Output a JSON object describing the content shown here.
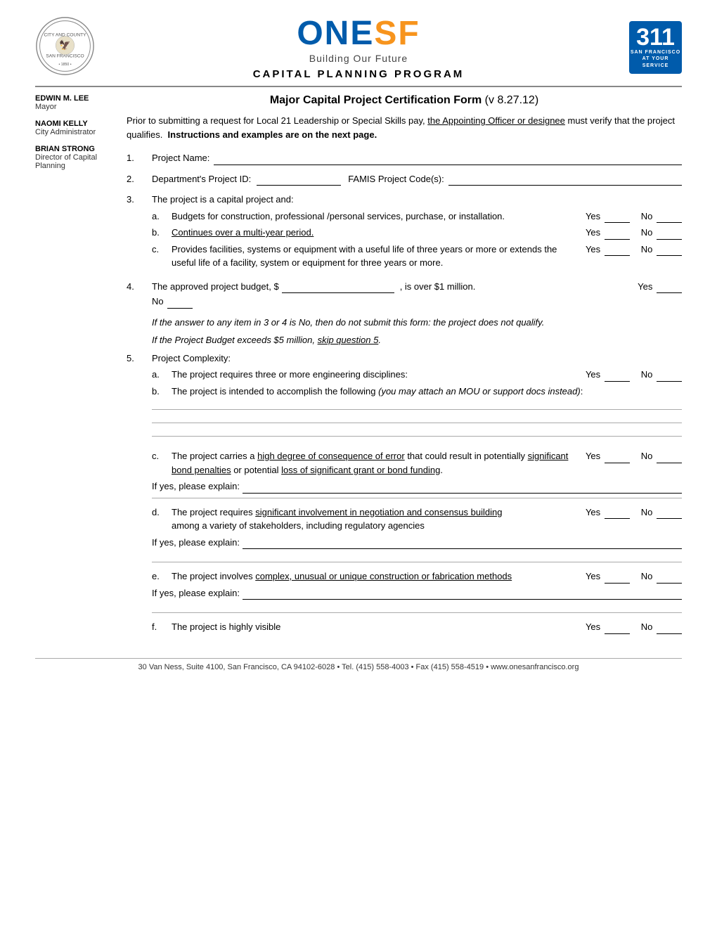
{
  "header": {
    "onesf_one": "ONE",
    "onesf_sf": "SF",
    "onesf_sub": "Building Our Future",
    "program_title": "CAPITAL PLANNING PROGRAM"
  },
  "badge": {
    "number": "311",
    "city": "SAN FRANCISCO",
    "service": "AT YOUR SERVICE"
  },
  "sidebar": {
    "person1_name": "EDWIN M. LEE",
    "person1_title": "Mayor",
    "person2_name": "NAOMI KELLY",
    "person2_title": "City Administrator",
    "person3_name": "BRIAN STRONG",
    "person3_title": "Director of Capital Planning"
  },
  "form": {
    "title": "Major Capital Project Certification Form",
    "version": "(v 8.27.12)",
    "intro": "Prior to submitting a request for Local 21 Leadership or Special Skills pay, the Appointing Officer or designee must verify that the project qualifies.",
    "intro_bold": "Instructions and examples are on the next page.",
    "q1_label": "Project Name:",
    "q2_dept_label": "Department's Project ID:",
    "q2_famis_label": "FAMIS Project Code(s):",
    "q3_label": "The project is a capital project and:",
    "q3a": "Budgets for construction, professional /personal services, purchase, or installation.",
    "q3b": "Continues over a multi-year period.",
    "q3c": "Provides facilities, systems or equipment with a useful life of three years or more or extends the useful life of a facility, system or equipment for three years or more.",
    "q4_label": "The approved  project budget, $",
    "q4_mid": ", is over $1 million.",
    "q4_yes": "Yes",
    "q4_no": "No",
    "italic_note1": "If the answer to any item in 3 or 4 is No, then do not submit this form: the project does not qualify.",
    "italic_note2": "If the Project Budget exceeds $5 million, skip question 5.",
    "q5_label": "Project Complexity:",
    "q5a": "The project requires three or more engineering disciplines:",
    "q5b_label": "The project is intended to accomplish the following",
    "q5b_paren": "(you may attach an MOU or support docs instead)",
    "q5c_label": "The project carries a",
    "q5c_underline": "high degree of consequence of error",
    "q5c_mid": "that could result in potentially",
    "q5c_underline2": "significant bond penalties",
    "q5c_mid2": "or potential",
    "q5c_underline3": "loss of significant grant or bond funding",
    "q5c_end": ".",
    "q5d_label": "The project requires",
    "q5d_underline": "significant involvement in negotiation and consensus building",
    "q5d_mid": "among a variety of stakeholders, including regulatory agencies",
    "q5e_label": "The project involves",
    "q5e_underline": "complex, unusual or unique construction or fabrication methods",
    "q5f_label": "The project is highly visible",
    "yes_label": "Yes",
    "no_label": "No",
    "if_yes_label": "If yes, please explain:",
    "footer": "30 Van Ness, Suite 4100, San Francisco, CA 94102-6028 • Tel. (415) 558-4003 • Fax (415) 558-4519 • www.onesanfrancisco.org"
  }
}
